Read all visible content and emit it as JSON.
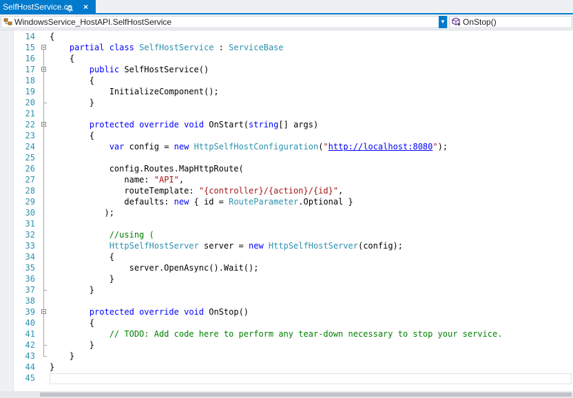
{
  "tab": {
    "title": "SelfHostService.cs",
    "pin_glyph": "pin-icon",
    "close_glyph": "×"
  },
  "navbar": {
    "type_combo": {
      "icon": "class-icon",
      "text": "WindowsService_HostAPI.SelfHostService"
    },
    "member_combo": {
      "icon": "method-icon",
      "text": "OnStop()"
    },
    "dropdown_glyph": "▼"
  },
  "colors": {
    "keyword": "#0000ff",
    "type": "#2b91af",
    "string": "#a31515",
    "comment": "#008000",
    "line_number": "#2b91af",
    "accent": "#007acc"
  },
  "code": {
    "lines": [
      {
        "n": "14",
        "fold": false,
        "tokens": [
          {
            "c": "pl",
            "t": "{"
          }
        ]
      },
      {
        "n": "15",
        "fold": true,
        "tokens": [
          {
            "c": "pl",
            "t": "    "
          },
          {
            "c": "kw",
            "t": "partial"
          },
          {
            "c": "pl",
            "t": " "
          },
          {
            "c": "kw",
            "t": "class"
          },
          {
            "c": "pl",
            "t": " "
          },
          {
            "c": "ty",
            "t": "SelfHostService"
          },
          {
            "c": "pl",
            "t": " : "
          },
          {
            "c": "ty",
            "t": "ServiceBase"
          }
        ]
      },
      {
        "n": "16",
        "fold": false,
        "tokens": [
          {
            "c": "pl",
            "t": "    {"
          }
        ]
      },
      {
        "n": "17",
        "fold": true,
        "tokens": [
          {
            "c": "pl",
            "t": "        "
          },
          {
            "c": "kw",
            "t": "public"
          },
          {
            "c": "pl",
            "t": " SelfHostService()"
          }
        ]
      },
      {
        "n": "18",
        "fold": false,
        "tokens": [
          {
            "c": "pl",
            "t": "        {"
          }
        ]
      },
      {
        "n": "19",
        "fold": false,
        "tokens": [
          {
            "c": "pl",
            "t": "            InitializeComponent();"
          }
        ]
      },
      {
        "n": "20",
        "fold": false,
        "tokens": [
          {
            "c": "pl",
            "t": "        }"
          }
        ]
      },
      {
        "n": "21",
        "fold": false,
        "tokens": []
      },
      {
        "n": "22",
        "fold": true,
        "tokens": [
          {
            "c": "pl",
            "t": "        "
          },
          {
            "c": "kw",
            "t": "protected"
          },
          {
            "c": "pl",
            "t": " "
          },
          {
            "c": "kw",
            "t": "override"
          },
          {
            "c": "pl",
            "t": " "
          },
          {
            "c": "kw",
            "t": "void"
          },
          {
            "c": "pl",
            "t": " OnStart("
          },
          {
            "c": "kw",
            "t": "string"
          },
          {
            "c": "pl",
            "t": "[] args)"
          }
        ]
      },
      {
        "n": "23",
        "fold": false,
        "tokens": [
          {
            "c": "pl",
            "t": "        {"
          }
        ]
      },
      {
        "n": "24",
        "fold": false,
        "tokens": [
          {
            "c": "pl",
            "t": "            "
          },
          {
            "c": "kw",
            "t": "var"
          },
          {
            "c": "pl",
            "t": " config = "
          },
          {
            "c": "kw",
            "t": "new"
          },
          {
            "c": "pl",
            "t": " "
          },
          {
            "c": "ty",
            "t": "HttpSelfHostConfiguration"
          },
          {
            "c": "pl",
            "t": "("
          },
          {
            "c": "str",
            "t": "\""
          },
          {
            "c": "url",
            "t": "http://localhost:8080"
          },
          {
            "c": "str",
            "t": "\""
          },
          {
            "c": "pl",
            "t": ");"
          }
        ]
      },
      {
        "n": "25",
        "fold": false,
        "tokens": []
      },
      {
        "n": "26",
        "fold": false,
        "tokens": [
          {
            "c": "pl",
            "t": "            config.Routes.MapHttpRoute("
          }
        ]
      },
      {
        "n": "27",
        "fold": false,
        "tokens": [
          {
            "c": "pl",
            "t": "               name: "
          },
          {
            "c": "str",
            "t": "\"API\""
          },
          {
            "c": "pl",
            "t": ","
          }
        ]
      },
      {
        "n": "28",
        "fold": false,
        "tokens": [
          {
            "c": "pl",
            "t": "               routeTemplate: "
          },
          {
            "c": "str",
            "t": "\"{controller}/{action}/{id}\""
          },
          {
            "c": "pl",
            "t": ","
          }
        ]
      },
      {
        "n": "29",
        "fold": false,
        "tokens": [
          {
            "c": "pl",
            "t": "               defaults: "
          },
          {
            "c": "kw",
            "t": "new"
          },
          {
            "c": "pl",
            "t": " { id = "
          },
          {
            "c": "ty",
            "t": "RouteParameter"
          },
          {
            "c": "pl",
            "t": ".Optional }"
          }
        ]
      },
      {
        "n": "30",
        "fold": false,
        "tokens": [
          {
            "c": "pl",
            "t": "           );"
          }
        ]
      },
      {
        "n": "31",
        "fold": false,
        "tokens": []
      },
      {
        "n": "32",
        "fold": false,
        "tokens": [
          {
            "c": "pl",
            "t": "            "
          },
          {
            "c": "cm",
            "t": "//using ("
          }
        ]
      },
      {
        "n": "33",
        "fold": false,
        "tokens": [
          {
            "c": "pl",
            "t": "            "
          },
          {
            "c": "ty",
            "t": "HttpSelfHostServer"
          },
          {
            "c": "pl",
            "t": " server = "
          },
          {
            "c": "kw",
            "t": "new"
          },
          {
            "c": "pl",
            "t": " "
          },
          {
            "c": "ty",
            "t": "HttpSelfHostServer"
          },
          {
            "c": "pl",
            "t": "(config);"
          }
        ]
      },
      {
        "n": "34",
        "fold": false,
        "tokens": [
          {
            "c": "pl",
            "t": "            {"
          }
        ]
      },
      {
        "n": "35",
        "fold": false,
        "tokens": [
          {
            "c": "pl",
            "t": "                server.OpenAsync().Wait();"
          }
        ]
      },
      {
        "n": "36",
        "fold": false,
        "tokens": [
          {
            "c": "pl",
            "t": "            }"
          }
        ]
      },
      {
        "n": "37",
        "fold": false,
        "tokens": [
          {
            "c": "pl",
            "t": "        }"
          }
        ]
      },
      {
        "n": "38",
        "fold": false,
        "tokens": []
      },
      {
        "n": "39",
        "fold": true,
        "tokens": [
          {
            "c": "pl",
            "t": "        "
          },
          {
            "c": "kw",
            "t": "protected"
          },
          {
            "c": "pl",
            "t": " "
          },
          {
            "c": "kw",
            "t": "override"
          },
          {
            "c": "pl",
            "t": " "
          },
          {
            "c": "kw",
            "t": "void"
          },
          {
            "c": "pl",
            "t": " OnStop()"
          }
        ]
      },
      {
        "n": "40",
        "fold": false,
        "tokens": [
          {
            "c": "pl",
            "t": "        {"
          }
        ]
      },
      {
        "n": "41",
        "fold": false,
        "tokens": [
          {
            "c": "pl",
            "t": "            "
          },
          {
            "c": "cm",
            "t": "// TODO: Add code here to perform any tear-down necessary to stop your service."
          }
        ]
      },
      {
        "n": "42",
        "fold": false,
        "tokens": [
          {
            "c": "pl",
            "t": "        }"
          }
        ]
      },
      {
        "n": "43",
        "fold": false,
        "tokens": [
          {
            "c": "pl",
            "t": "    }"
          }
        ]
      },
      {
        "n": "44",
        "fold": false,
        "tokens": [
          {
            "c": "pl",
            "t": "}"
          }
        ]
      },
      {
        "n": "45",
        "fold": false,
        "tokens": []
      }
    ]
  }
}
